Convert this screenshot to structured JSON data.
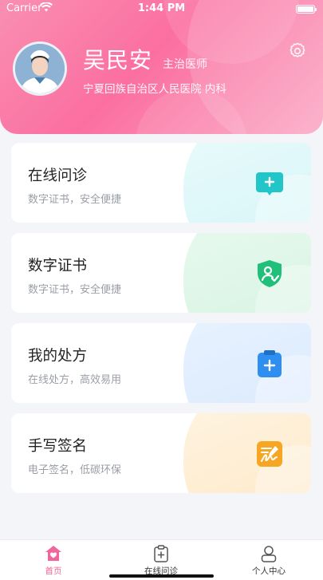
{
  "status_bar": {
    "carrier": "Carrier",
    "time": "1:44 PM"
  },
  "profile": {
    "name": "吴民安",
    "title": "主治医师",
    "hospital": "宁夏回族自治区人民医院 内科"
  },
  "cards": [
    {
      "title": "在线问诊",
      "subtitle": "数字证书，安全便捷",
      "icon": "chat-plus-icon",
      "color": "#22c6c9"
    },
    {
      "title": "数字证书",
      "subtitle": "数字证书，安全便捷",
      "icon": "shield-certificate-icon",
      "color": "#21c07a"
    },
    {
      "title": "我的处方",
      "subtitle": "在线处方，高效易用",
      "icon": "clipboard-plus-icon",
      "color": "#2f8ff0"
    },
    {
      "title": "手写签名",
      "subtitle": "电子签名，低碳环保",
      "icon": "signature-icon",
      "color": "#f6a623"
    }
  ],
  "tabbar": [
    {
      "label": "首页",
      "icon": "home-icon",
      "active": true
    },
    {
      "label": "在线问诊",
      "icon": "clipboard-plus-icon",
      "active": false
    },
    {
      "label": "个人中心",
      "icon": "user-icon",
      "active": false
    }
  ],
  "colors": {
    "accent": "#f0659a",
    "header_start": "#f98fb2",
    "header_end": "#fba7c4"
  }
}
